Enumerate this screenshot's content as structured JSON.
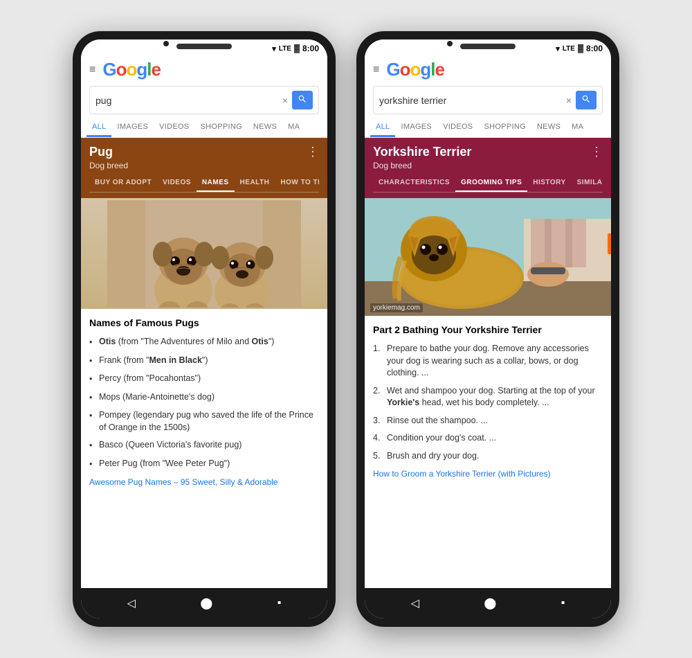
{
  "phone1": {
    "statusBar": {
      "time": "8:00",
      "signal": "LTE"
    },
    "header": {
      "menuIcon": "≡",
      "logo": {
        "G": "G",
        "o1": "o",
        "o2": "o",
        "g": "g",
        "l": "l",
        "e": "e"
      }
    },
    "searchBar": {
      "value": "pug",
      "placeholder": "Search",
      "clearButton": "×",
      "searchIcon": "🔍"
    },
    "tabs": [
      "ALL",
      "IMAGES",
      "VIDEOS",
      "SHOPPING",
      "NEWS",
      "MA"
    ],
    "activeTab": "ALL",
    "knowledgePanel": {
      "title": "Pug",
      "subtitle": "Dog breed",
      "menuIcon": "⋮",
      "tabs": [
        "BUY OR ADOPT",
        "VIDEOS",
        "NAMES",
        "HEALTH",
        "HOW TO TRAIN"
      ],
      "activeTab": "NAMES",
      "bgColor": "#8B4513"
    },
    "content": {
      "sectionTitle": "Names of Famous Pugs",
      "items": [
        {
          "name": "Otis",
          "desc": " (from \"The Adventures of Milo and ",
          "bold2": "Otis",
          "end": "\")"
        },
        {
          "name": "Frank",
          "desc": " (from \"",
          "bold2": "Men in Black",
          "end": "\")"
        },
        {
          "name": "Percy",
          "desc": " (from \"Pocahontas\")"
        },
        {
          "name": "Mops",
          "desc": " (Marie-Antoinette's dog)"
        },
        {
          "name": "Pompey",
          "desc": " (legendary pug who saved the life of the Prince of Orange in the 1500s)"
        },
        {
          "name": "Basco",
          "desc": " (Queen Victoria's favorite pug)"
        },
        {
          "name": "Peter Pug",
          "desc": " (from \"Wee Peter Pug\")"
        }
      ],
      "linkText": "Awesome Pug Names – 95 Sweet, Silly & Adorable"
    }
  },
  "phone2": {
    "statusBar": {
      "time": "8:00",
      "signal": "LTE"
    },
    "header": {
      "menuIcon": "≡"
    },
    "searchBar": {
      "value": "yorkshire terrier",
      "placeholder": "Search",
      "clearButton": "×",
      "searchIcon": "🔍"
    },
    "tabs": [
      "ALL",
      "IMAGES",
      "VIDEOS",
      "SHOPPING",
      "NEWS",
      "MA"
    ],
    "activeTab": "ALL",
    "knowledgePanel": {
      "title": "Yorkshire Terrier",
      "subtitle": "Dog breed",
      "menuIcon": "⋮",
      "tabs": [
        "CHARACTERISTICS",
        "GROOMING TIPS",
        "HISTORY",
        "SIMILAR BRE"
      ],
      "activeTab": "GROOMING TIPS",
      "bgColor": "#8B1C3E"
    },
    "content": {
      "imageSource": "yorkiemag.com",
      "sectionTitle": "Part 2 Bathing Your Yorkshire Terrier",
      "steps": [
        "Prepare to bathe your dog. Remove any accessories your dog is wearing such as a collar, bows, or dog clothing. ...",
        "Wet and shampoo your dog. Starting at the top of your Yorkie's head, wet his body completely. ...",
        "Rinse out the shampoo. ...",
        "Condition your dog's coat. ...",
        "Brush and dry your dog."
      ],
      "step2Bold": "Yorkie's",
      "linkText": "How to Groom a Yorkshire Terrier (with Pictures)"
    }
  }
}
